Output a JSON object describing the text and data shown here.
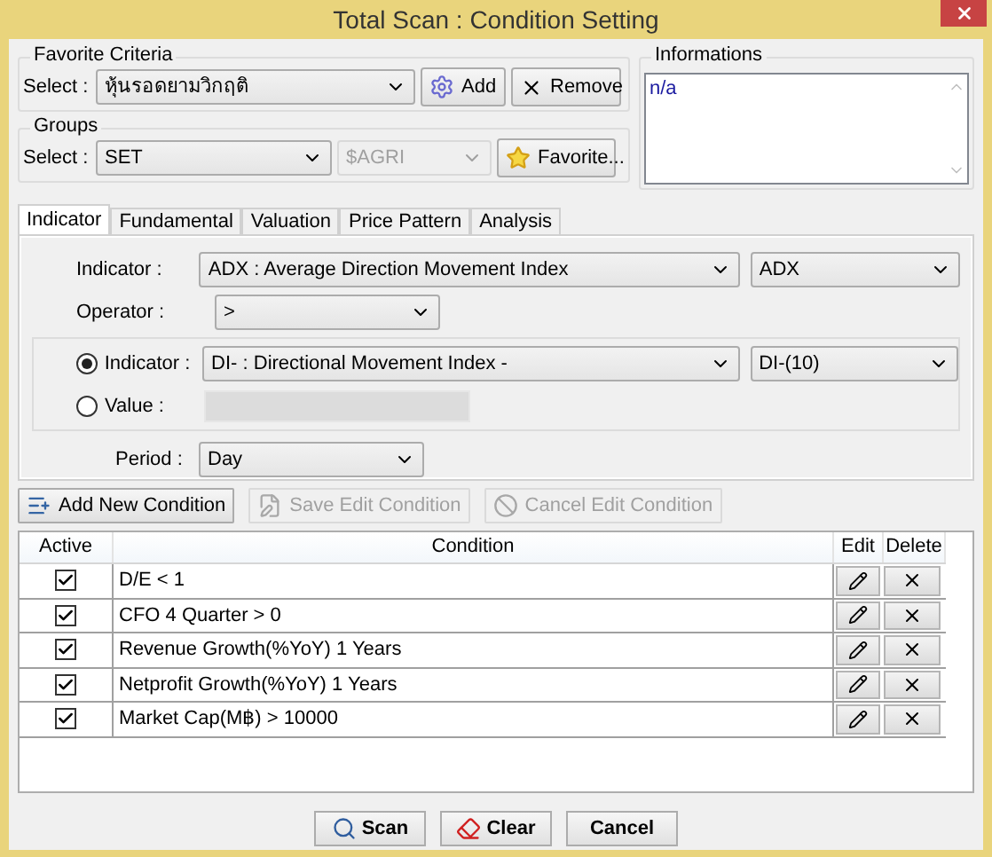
{
  "window": {
    "title": "Total Scan : Condition Setting"
  },
  "favorite_criteria": {
    "title": "Favorite Criteria",
    "select_label": "Select :",
    "value": "หุ้นรอดยามวิกฤติ",
    "add_button": "Add",
    "remove_button": "Remove"
  },
  "groups": {
    "title": "Groups",
    "select_label": "Select :",
    "group": "SET",
    "subgroup": {
      "value": "$AGRI",
      "disabled": true
    },
    "favorite_button": "Favorite..."
  },
  "informations": {
    "title": "Informations",
    "text": "n/a"
  },
  "tabs": [
    {
      "label": "Indicator",
      "selected": true
    },
    {
      "label": "Fundamental",
      "selected": false
    },
    {
      "label": "Valuation",
      "selected": false
    },
    {
      "label": "Price Pattern",
      "selected": false
    },
    {
      "label": "Analysis",
      "selected": false
    }
  ],
  "indicator_panel": {
    "indicator_label": "Indicator :",
    "indicator": "ADX : Average Direction Movement Index",
    "indicator_line": "ADX",
    "operator_label": "Operator :",
    "operator": ">",
    "compare": [
      {
        "kind": "indicator",
        "label": "Indicator :",
        "selected": true,
        "value": "DI- : Directional Movement Index -",
        "line": "DI-(10)"
      },
      {
        "kind": "value",
        "label": "Value :",
        "selected": false,
        "disabled": true
      }
    ],
    "period_label": "Period :",
    "period": "Day"
  },
  "condition_buttons": [
    {
      "kind": "add",
      "label": "Add New Condition",
      "disabled": false
    },
    {
      "kind": "save",
      "label": "Save Edit Condition",
      "disabled": true
    },
    {
      "kind": "cancel",
      "label": "Cancel Edit Condition",
      "disabled": true
    }
  ],
  "table": {
    "columns": [
      "Active",
      "Condition",
      "Edit",
      "Delete"
    ],
    "rows": [
      {
        "active": true,
        "condition": "D/E < 1"
      },
      {
        "active": true,
        "condition": "CFO 4 Quarter > 0"
      },
      {
        "active": true,
        "condition": "Revenue Growth(%YoY) 1 Years"
      },
      {
        "active": true,
        "condition": "Netprofit Growth(%YoY) 1 Years"
      },
      {
        "active": true,
        "condition": "Market Cap(M฿) > 10000"
      }
    ]
  },
  "buttons": [
    {
      "kind": "scan",
      "label": "Scan"
    },
    {
      "kind": "clear",
      "label": "Clear"
    },
    {
      "kind": "cancel",
      "label": "Cancel"
    }
  ]
}
